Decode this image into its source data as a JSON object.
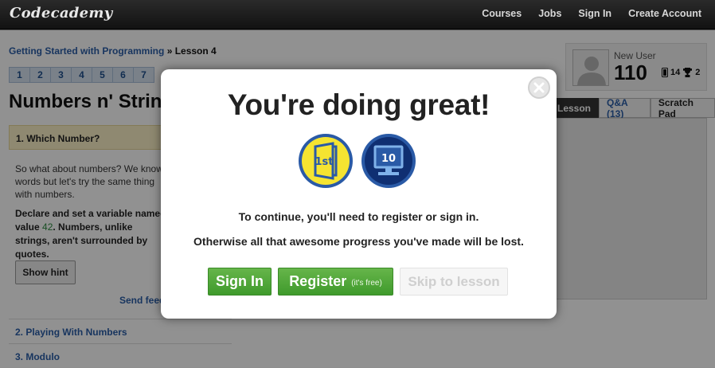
{
  "navbar": {
    "logo": "Codecademy",
    "links": [
      "Courses",
      "Jobs",
      "Sign In",
      "Create Account"
    ]
  },
  "breadcrumb": {
    "course": "Getting Started with Programming",
    "separator": " » ",
    "lesson": "Lesson 4"
  },
  "steps": [
    "1",
    "2",
    "3",
    "4",
    "5",
    "6",
    "7"
  ],
  "lesson_title": "Numbers n' Strings",
  "exercise": {
    "current": "1. Which Number?",
    "instructions_text": "So what about numbers? We know words but let's try the same thing with numbers.",
    "instructions_bold_a": "Declare and set a variable named",
    "instructions_bold_b": "value ",
    "instructions_num": "42",
    "instructions_bold_c": ". Numbers, unlike strings, aren't surrounded by quotes.",
    "hint_button": "Show hint",
    "send_feedback": "Send feedback",
    "next_items": [
      "2. Playing With Numbers",
      "3. Modulo"
    ]
  },
  "user": {
    "name": "New User",
    "points": "110",
    "badges_count": "14",
    "trophies_count": "2"
  },
  "tabs": [
    "Lesson",
    "Q&A (13)",
    "Scratch Pad"
  ],
  "modal": {
    "heading": "You're doing great!",
    "badge_1_text": "1st",
    "badge_2_text": "10",
    "message_1": "To continue, you'll need to register or sign in.",
    "message_2": "Otherwise all that awesome progress you've made will be lost.",
    "signin_label": "Sign In",
    "register_label": "Register",
    "register_sub": "(it's free)",
    "skip_label": "Skip to lesson"
  },
  "colors": {
    "accent_green": "#4aa535",
    "link_blue": "#2b5ea8",
    "badge_yellow": "#f5e431",
    "badge_blue": "#2a5aa6"
  }
}
